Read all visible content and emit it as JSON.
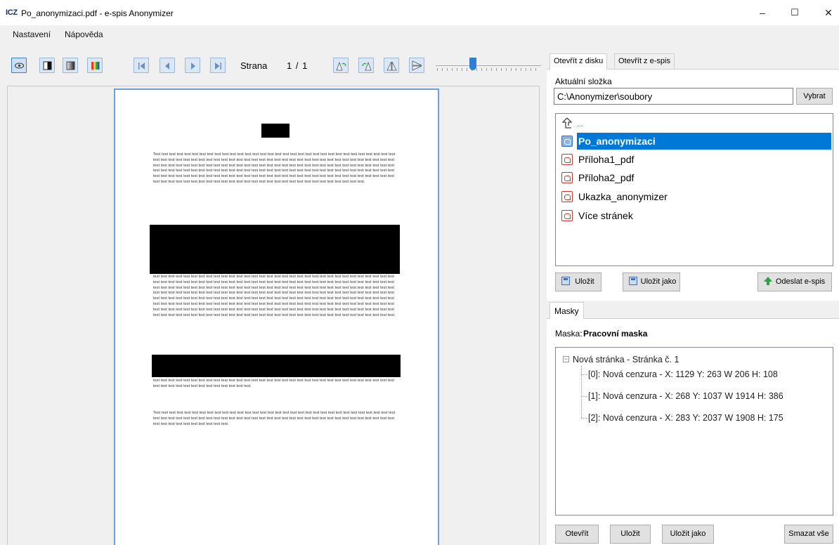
{
  "window": {
    "logo": "ICZ",
    "title": "Po_anonymizaci.pdf - e-spis Anonymizer",
    "minimize": "–",
    "maximize": "☐",
    "close": "✕"
  },
  "menu": [
    "Nastavení",
    "Nápověda"
  ],
  "toolbar": {
    "strana_label": "Strana",
    "page_count": "1 / 1"
  },
  "document": {
    "paragraph1": "Test test test test test test test test test test test test test test test test test test test test test test test test test test test test test test test test test test test test test test test test test test test test test test test test test test test test test test test test test test test test test test test test test test test test test test test test test test test test test test test test test test test test test test test test test test test test test test test test test test test test test test test test test test test test test test test test test test test test test test test test test test test test test test test test test test test test test test test test test test test test test test test test test test test test test test test test test test test test test test test test test test test test test test test test test test test test test test test test test test test test test test test test test test test test.",
    "paragraph2": "test test test test test test test test test test test test test test test test test test test test test test test test test test test test test test test test test test test test test test test test test test test test test test test test test test test test test test test test test test test test test test test test test test test test test test test test test test test test test test test test test test test test test test test test test test test test test test test test test test test test test test test test test test test test test test test test test test test test test test test test test test test test test test test test test test test test test test test test test test test test test test test test test test test test test test test test test test test test test test test test test test test test test test test test test test test test test test test test test test test test test test test test test test test test test test test test test test test test test test test test test test test test test test test test test test test test test test test test test test test test test test test test test test test test test test test test test test test test test test test test test test test test test test test test test test test test test test test test.",
    "paragraph3": "test test test test test test test test test test test test test test test test test test test test test test test test test test test test test test test test test test test test test test test test test test test test test.",
    "paragraph4": "Test test test test test test test test test test test test test test test test test test test test test test test test test test test test test test test test test test test test test test test test test test test test test test test test test test test test test test test test test test test test test test test test test test test test test test test test test test."
  },
  "right_panel": {
    "tabs": [
      "Otevřít z disku",
      "Otevřít z e-spis"
    ],
    "folder_label": "Aktuální složka",
    "folder_value": "C:\\Anonymizer\\soubory",
    "choose_button": "Vybrat",
    "up_label": "...",
    "files": [
      {
        "name": "Po_anonymizaci",
        "selected": true
      },
      {
        "name": "Příloha1_pdf",
        "selected": false
      },
      {
        "name": "Příloha2_pdf",
        "selected": false
      },
      {
        "name": "Ukazka_anonymizer",
        "selected": false
      },
      {
        "name": "Více stránek",
        "selected": false
      }
    ],
    "save_button": "Uložit",
    "save_as_button": "Uložit jako",
    "send_button": "Odeslat e-spis"
  },
  "masks": {
    "tab_label": "Masky",
    "mask_label": "Maska:",
    "mask_name": "Pracovní maska",
    "tree_root": "Nová stránka - Stránka č. 1",
    "tree_children": [
      "[0]: Nová cenzura - X: 1129 Y: 263 W 206 H: 108",
      "[1]: Nová cenzura - X: 268 Y: 1037 W 1914 H: 386",
      "[2]: Nová cenzura - X: 283 Y: 2037 W 1908 H: 175"
    ],
    "open_button": "Otevřít",
    "save_button": "Uložit",
    "save_as_button": "Uložit jako",
    "delete_all_button": "Smazat vše"
  }
}
